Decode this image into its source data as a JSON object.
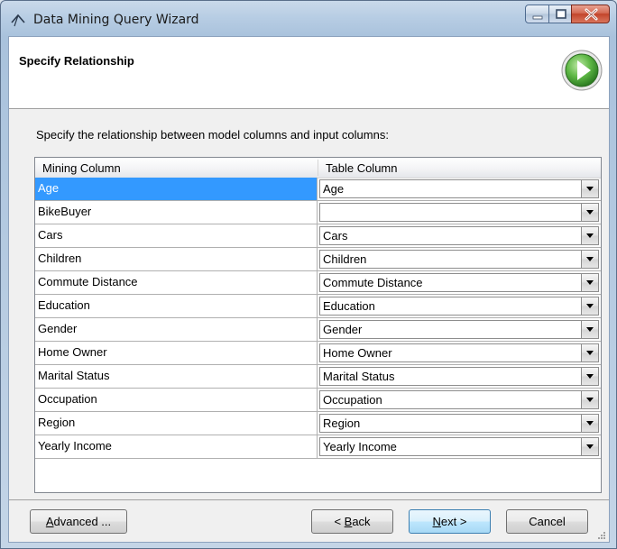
{
  "window": {
    "title": "Data Mining Query Wizard"
  },
  "header": {
    "title": "Specify Relationship"
  },
  "instruction": "Specify the relationship between model columns and input columns:",
  "grid": {
    "columns": [
      "Mining Column",
      "Table Column"
    ],
    "rows": [
      {
        "mining": "Age",
        "table": "Age"
      },
      {
        "mining": "BikeBuyer",
        "table": ""
      },
      {
        "mining": "Cars",
        "table": "Cars"
      },
      {
        "mining": "Children",
        "table": "Children"
      },
      {
        "mining": "Commute Distance",
        "table": "Commute Distance"
      },
      {
        "mining": "Education",
        "table": "Education"
      },
      {
        "mining": "Gender",
        "table": "Gender"
      },
      {
        "mining": "Home Owner",
        "table": "Home Owner"
      },
      {
        "mining": "Marital Status",
        "table": "Marital Status"
      },
      {
        "mining": "Occupation",
        "table": "Occupation"
      },
      {
        "mining": "Region",
        "table": "Region"
      },
      {
        "mining": "Yearly Income",
        "table": "Yearly Income"
      }
    ],
    "selected_index": 0
  },
  "buttons": {
    "advanced_mnemonic": "A",
    "advanced_rest": "dvanced ...",
    "back_prefix": "< ",
    "back_mnemonic": "B",
    "back_rest": "ack",
    "next_mnemonic": "N",
    "next_rest": "ext >",
    "cancel": "Cancel"
  },
  "colors": {
    "selection": "#3399ff",
    "close_button": "#c2452b",
    "wizard_icon_green": "#3a9a2a"
  }
}
